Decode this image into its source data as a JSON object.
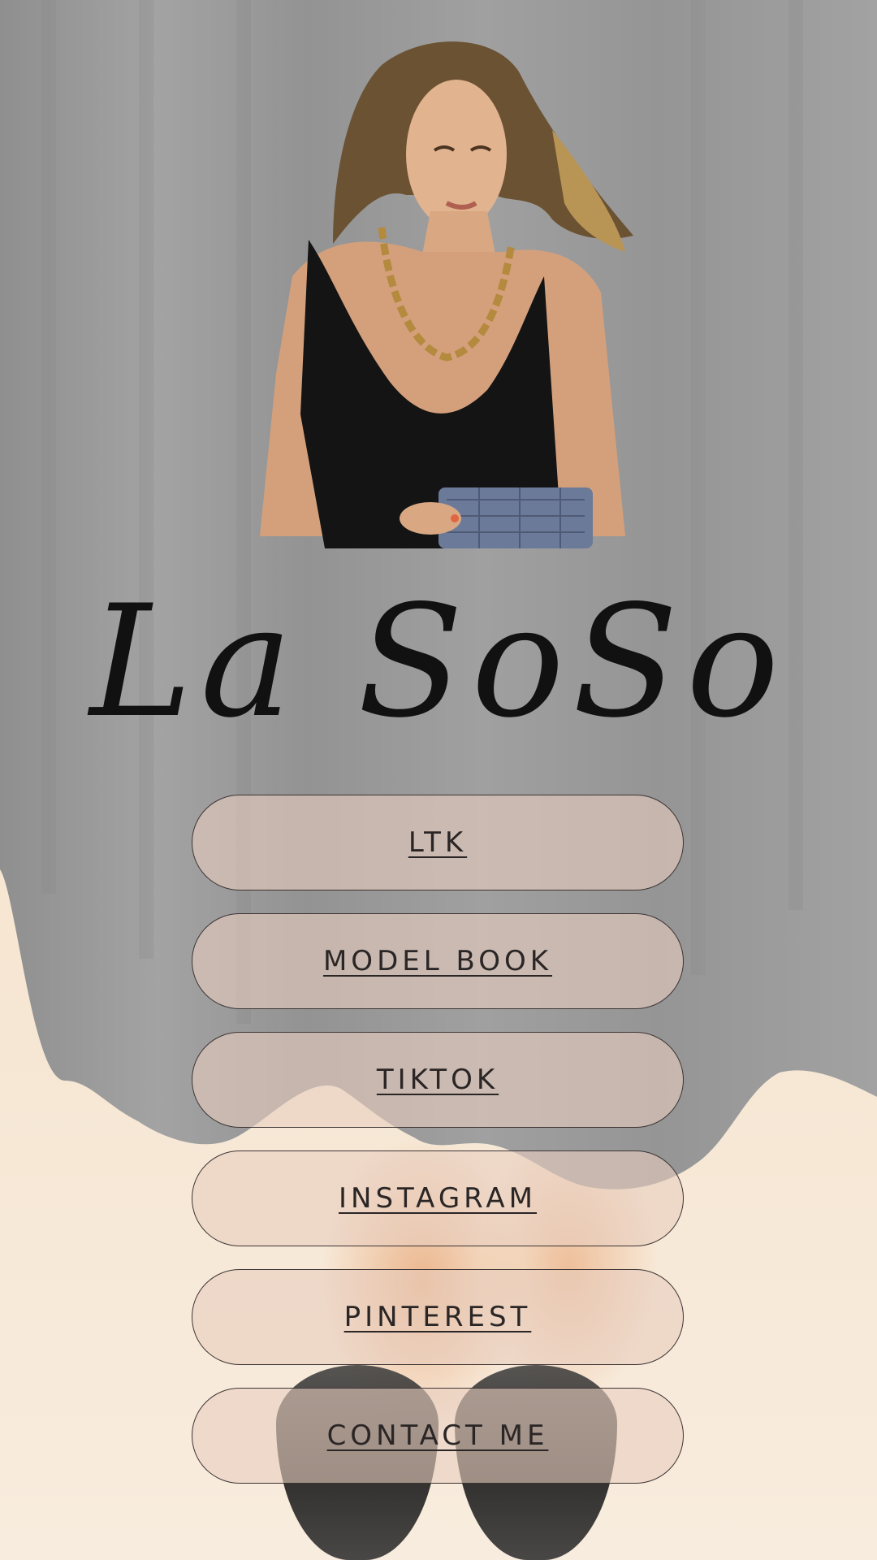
{
  "brand": {
    "logo_text": "La SoSo"
  },
  "profile": {
    "portrait_alt": "profile photo"
  },
  "links": [
    {
      "label": "LTK"
    },
    {
      "label": "MODEL BOOK"
    },
    {
      "label": "TIKTOK"
    },
    {
      "label": "INSTAGRAM"
    },
    {
      "label": "PINTEREST"
    },
    {
      "label": "CONTACT ME"
    }
  ],
  "colors": {
    "background_fabric": "#9d9d9d",
    "background_sand": "#f6e8d6",
    "button_fill": "#dcc4b8",
    "button_border": "#3d3535",
    "text": "#2b2626"
  }
}
